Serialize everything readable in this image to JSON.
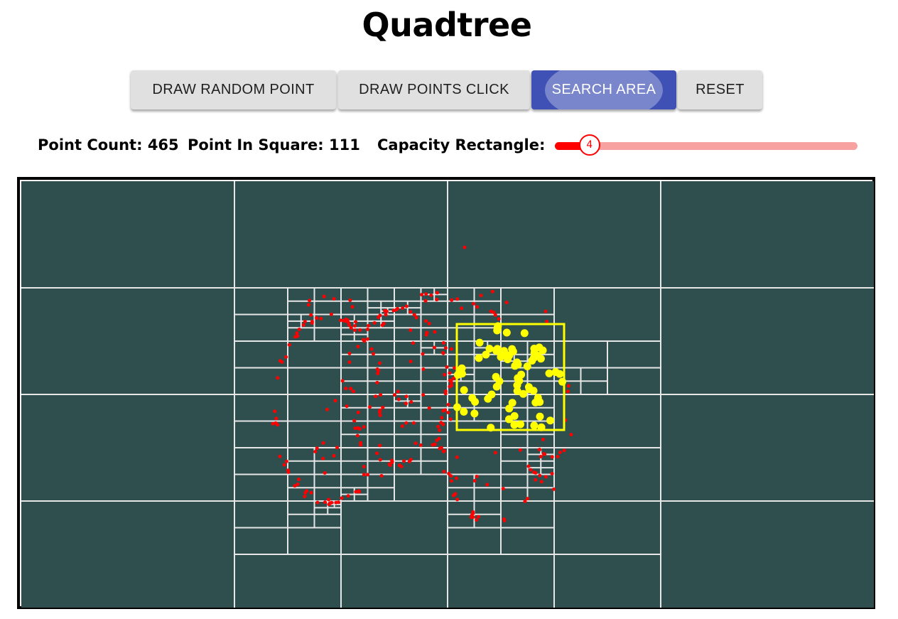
{
  "page": {
    "title": "Quadtree"
  },
  "toolbar": {
    "draw_random_label": "DRAW RANDOM POINT",
    "draw_click_label": "DRAW POINTS CLICK",
    "search_area_label": "SEARCH AREA",
    "reset_label": "RESET",
    "active_mode": "SEARCH AREA"
  },
  "stats": {
    "point_count_label": "Point Count:",
    "point_count_value": "465",
    "point_in_square_label": "Point In Square:",
    "point_in_square_value": "111",
    "capacity_label": "Capacity Rectangle:"
  },
  "capacity_slider": {
    "value": "4",
    "fraction": 0.11
  },
  "colors": {
    "canvas_background": "#2f4f4f",
    "grid_lines": "#e6e6e6",
    "points": "#ff0000",
    "found_points": "#ffff00",
    "search_rect": "#ffff00",
    "accent": "#3f51b5"
  }
}
